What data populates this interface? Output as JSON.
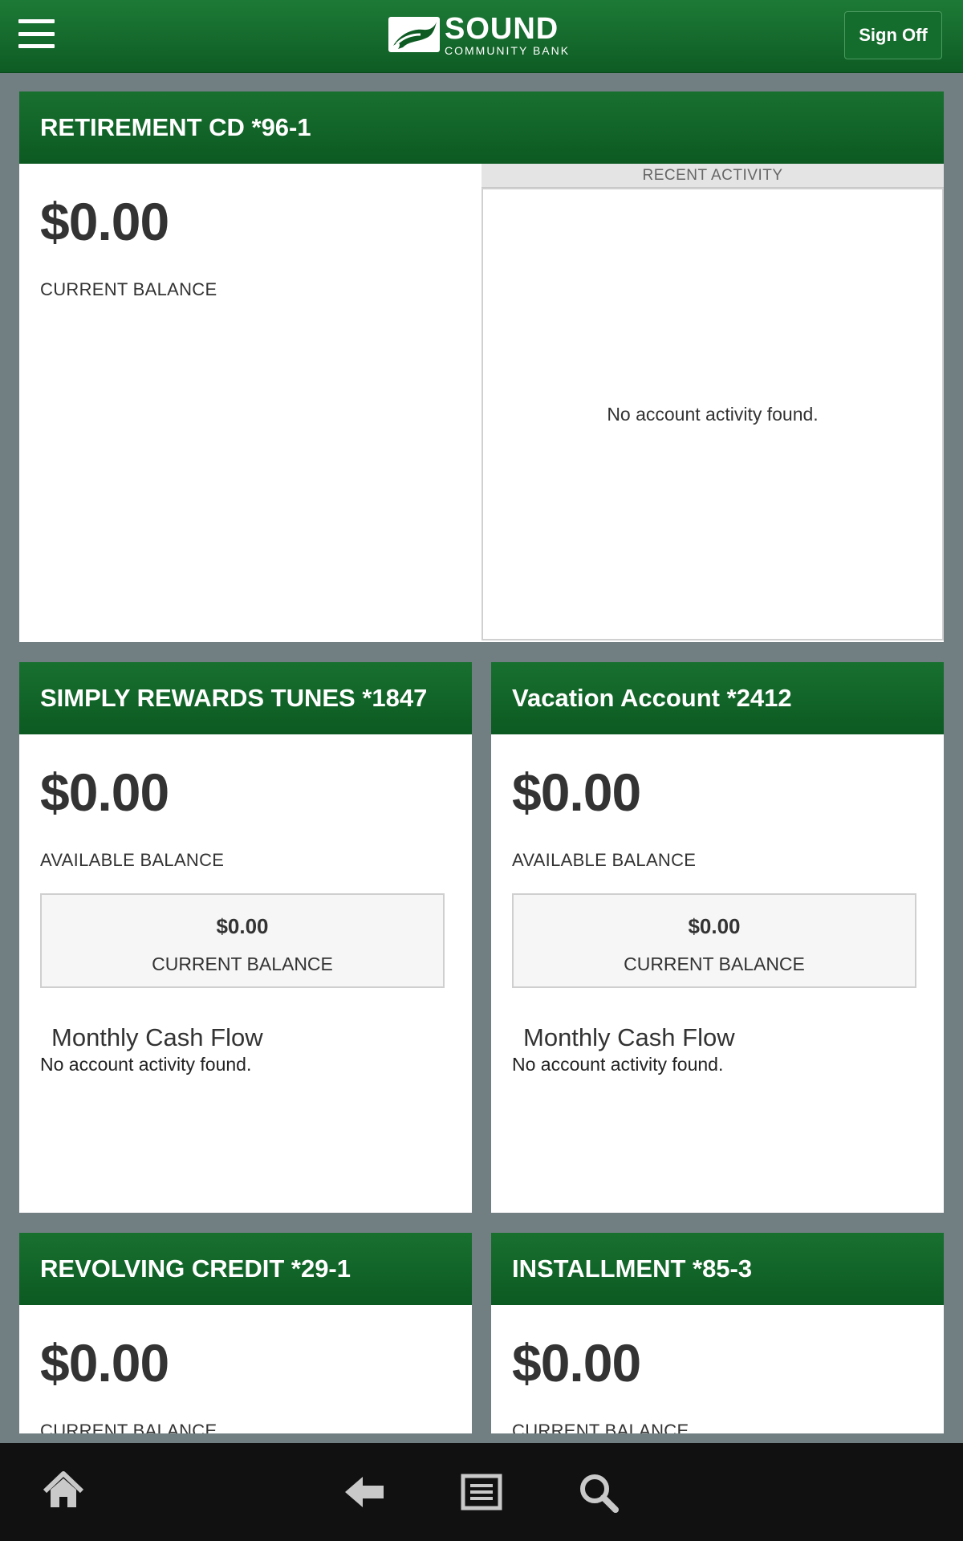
{
  "header": {
    "menu_icon": "hamburger-menu-icon",
    "logo": {
      "name": "SOUND",
      "sub": "COMMUNITY BANK"
    },
    "signoff_label": "Sign Off"
  },
  "accounts": {
    "retirement": {
      "title": "RETIREMENT CD *96-1",
      "amount": "$0.00",
      "balance_label": "CURRENT BALANCE",
      "activity_header": "RECENT ACTIVITY",
      "activity_empty": "No account activity found."
    },
    "rewards": {
      "title": "SIMPLY REWARDS TUNES *1847",
      "amount": "$0.00",
      "balance_label": "AVAILABLE BALANCE",
      "current_amount": "$0.00",
      "current_label": "CURRENT BALANCE",
      "cashflow_title": "Monthly Cash Flow",
      "cashflow_empty": "No account activity found."
    },
    "vacation": {
      "title": "Vacation Account *2412",
      "amount": "$0.00",
      "balance_label": "AVAILABLE BALANCE",
      "current_amount": "$0.00",
      "current_label": "CURRENT BALANCE",
      "cashflow_title": "Monthly Cash Flow",
      "cashflow_empty": "No account activity found."
    },
    "revolving": {
      "title": "REVOLVING CREDIT *29-1",
      "amount": "$0.00",
      "balance_label": "CURRENT BALANCE"
    },
    "installment": {
      "title": "INSTALLMENT *85-3",
      "amount": "$0.00",
      "balance_label": "CURRENT BALANCE"
    }
  },
  "bottom_nav": [
    "home-icon",
    "back-arrow-icon",
    "list-icon",
    "search-icon"
  ],
  "colors": {
    "header_green": "#0e5c24",
    "background": "#717f83",
    "nav_bar": "#111111"
  }
}
